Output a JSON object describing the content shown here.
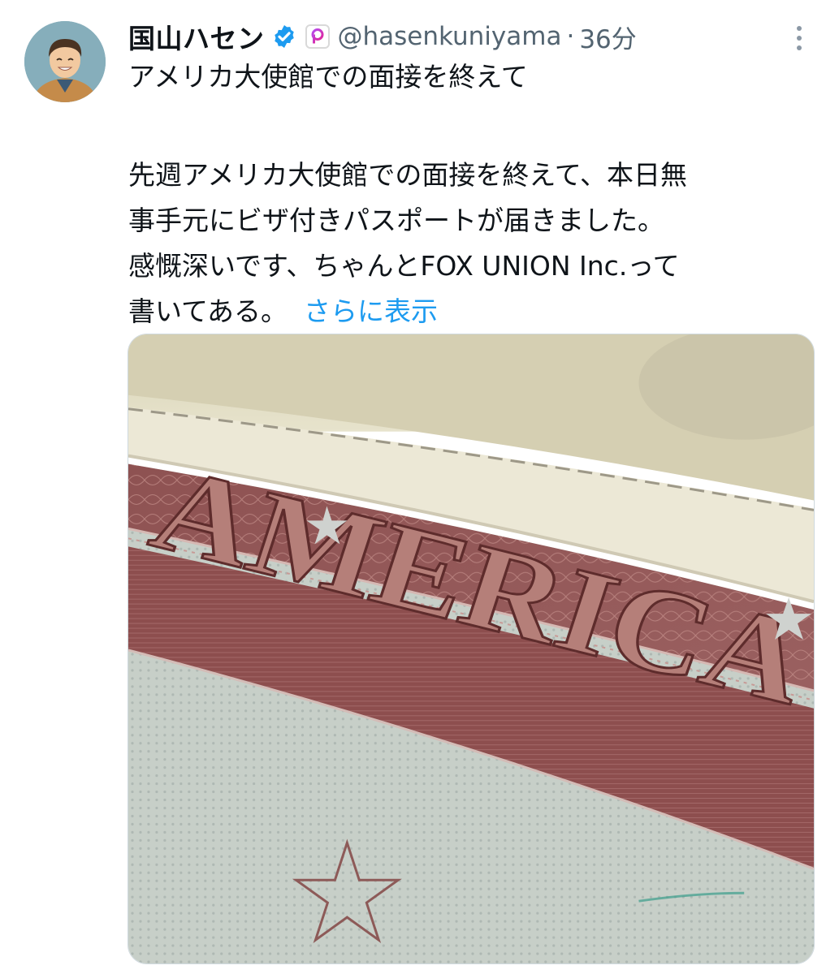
{
  "user": {
    "display_name": "国山ハセン",
    "handle": "@hasenkuniyama",
    "separator": "·",
    "time": "36分",
    "avatar_icon": "avatar-illustration",
    "verified_icon": "verified-badge-icon",
    "affiliate_icon": "affiliate-p-icon"
  },
  "post": {
    "title": "アメリカ大使館での面接を終えて",
    "body_lines": [
      "先週アメリカ大使館での面接を終えて、本日無",
      "事手元にビザ付きパスポートが届きました。",
      "感慨深いです、ちゃんとFOX UNION Inc.って",
      "書いてある。"
    ],
    "show_more": "さらに表示"
  },
  "media": {
    "image_text": "AMERICA"
  },
  "colors": {
    "accent": "#1d9bf0",
    "text": "#0f1419",
    "muted": "#536471",
    "visa_red": "#8a4a4a"
  }
}
